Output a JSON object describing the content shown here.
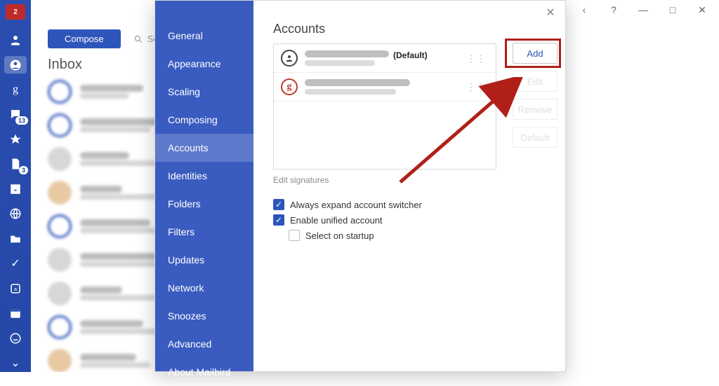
{
  "titlebar": {
    "back": "‹",
    "help": "?",
    "min": "—",
    "max": "□",
    "close": "✕"
  },
  "rail": {
    "logo_badge": "2",
    "contacts_badge": "13",
    "folders_badge": "3"
  },
  "app": {
    "compose": "Compose",
    "search_placeholder": "Search",
    "folder_title": "Inbox"
  },
  "modal": {
    "close_glyph": "✕",
    "sidebar": {
      "items": [
        {
          "label": "General"
        },
        {
          "label": "Appearance"
        },
        {
          "label": "Scaling"
        },
        {
          "label": "Composing"
        },
        {
          "label": "Accounts"
        },
        {
          "label": "Identities"
        },
        {
          "label": "Folders"
        },
        {
          "label": "Filters"
        },
        {
          "label": "Updates"
        },
        {
          "label": "Network"
        },
        {
          "label": "Snoozes"
        },
        {
          "label": "Advanced"
        },
        {
          "label": "About Mailbird"
        }
      ],
      "selected_index": 4
    },
    "section_title": "Accounts",
    "default_tag": "(Default)",
    "google_glyph": "g",
    "buttons": {
      "add": "Add",
      "edit": "Edit",
      "remove": "Remove",
      "default": "Default"
    },
    "edit_signatures": "Edit signatures",
    "checks": {
      "always_expand": "Always expand account switcher",
      "enable_unified": "Enable unified account",
      "select_startup": "Select on startup"
    }
  }
}
